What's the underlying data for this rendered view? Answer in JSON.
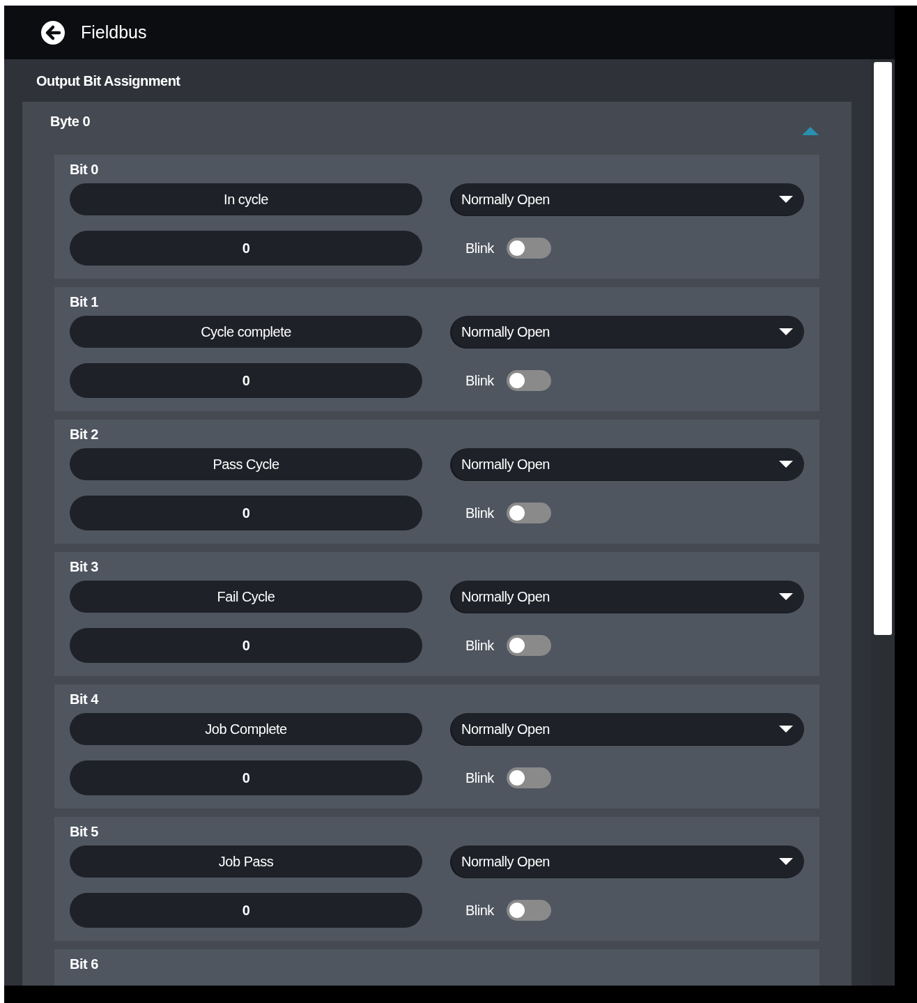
{
  "header": {
    "title": "Fieldbus"
  },
  "section": {
    "title": "Output Bit Assignment"
  },
  "byte": {
    "title": "Byte 0",
    "expanded": true
  },
  "bits": [
    {
      "title": "Bit 0",
      "function": "In cycle",
      "mode": "Normally Open",
      "value": "0",
      "blink_label": "Blink",
      "blink": false
    },
    {
      "title": "Bit 1",
      "function": "Cycle complete",
      "mode": "Normally Open",
      "value": "0",
      "blink_label": "Blink",
      "blink": false
    },
    {
      "title": "Bit 2",
      "function": "Pass Cycle",
      "mode": "Normally Open",
      "value": "0",
      "blink_label": "Blink",
      "blink": false
    },
    {
      "title": "Bit 3",
      "function": "Fail Cycle",
      "mode": "Normally Open",
      "value": "0",
      "blink_label": "Blink",
      "blink": false
    },
    {
      "title": "Bit 4",
      "function": "Job Complete",
      "mode": "Normally Open",
      "value": "0",
      "blink_label": "Blink",
      "blink": false
    },
    {
      "title": "Bit 5",
      "function": "Job Pass",
      "mode": "Normally Open",
      "value": "0",
      "blink_label": "Blink",
      "blink": false
    },
    {
      "title": "Bit 6"
    }
  ]
}
